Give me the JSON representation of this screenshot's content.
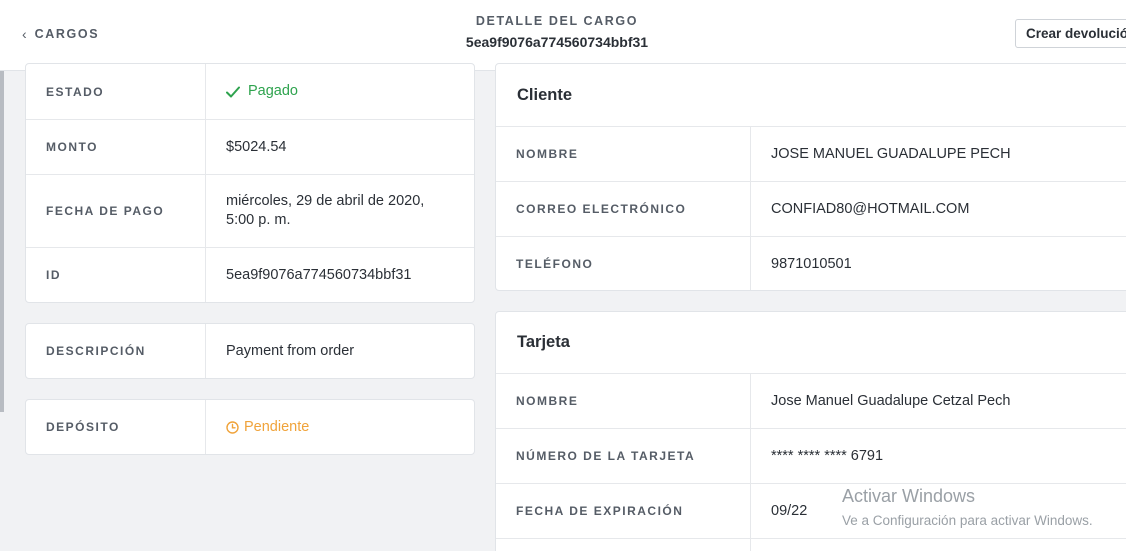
{
  "header": {
    "back_label": "CARGOS",
    "subtitle": "DETALLE DEL CARGO",
    "charge_id": "5ea9f9076a774560734bbf31",
    "refund_button": "Crear devolución"
  },
  "details": {
    "status_label": "ESTADO",
    "status_value": "Pagado",
    "amount_label": "MONTO",
    "amount_value": "$5024.54",
    "payment_date_label": "FECHA DE PAGO",
    "payment_date_line1": "miércoles, 29 de abril de 2020,",
    "payment_date_line2": "5:00 p. m.",
    "id_label": "ID",
    "id_value": "5ea9f9076a774560734bbf31"
  },
  "description": {
    "label": "DESCRIPCIÓN",
    "value": "Payment from order"
  },
  "deposit": {
    "label": "DEPÓSITO",
    "value": "Pendiente"
  },
  "customer": {
    "title": "Cliente",
    "name_label": "NOMBRE",
    "name_value": "JOSE MANUEL GUADALUPE PECH",
    "email_label": "CORREO ELECTRÓNICO",
    "email_value": "CONFIAD80@HOTMAIL.COM",
    "phone_label": "TELÉFONO",
    "phone_value": "9871010501"
  },
  "card": {
    "title": "Tarjeta",
    "name_label": "NOMBRE",
    "name_value": "Jose Manuel Guadalupe Cetzal Pech",
    "number_label": "NÚMERO DE LA TARJETA",
    "number_value": "**** **** **** 6791",
    "expiry_label": "FECHA DE EXPIRACIÓN",
    "expiry_value": "09/22"
  },
  "watermark": {
    "line1": "Activar Windows",
    "line2": "Ve a Configuración para activar Windows."
  },
  "colors": {
    "paid": "#2ea34e",
    "pending": "#f0a33a"
  },
  "icons": {
    "back": "chevron-left-icon",
    "paid": "checkmark-icon",
    "pending": "clock-icon"
  }
}
